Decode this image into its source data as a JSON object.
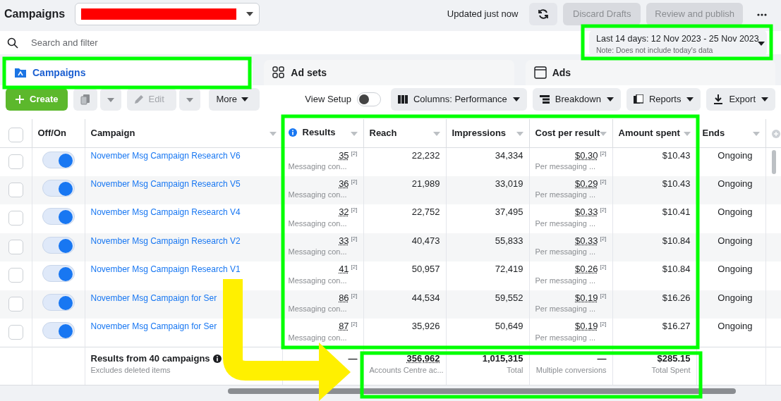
{
  "header": {
    "title": "Campaigns",
    "updated": "Updated just now",
    "buttons": [
      {
        "label": "Discard Drafts",
        "disabled": true
      },
      {
        "label": "Review and publish",
        "disabled": true
      }
    ]
  },
  "search": {
    "placeholder": "Search and filter"
  },
  "date_range": {
    "label": "Last 14 days: 12 Nov 2023 - 25 Nov 2023",
    "note": "Note: Does not include today's data"
  },
  "tabs": [
    {
      "label": "Campaigns",
      "kind": "campaigns",
      "selected": true
    },
    {
      "label": "Ad sets",
      "kind": "adsets",
      "selected": false
    },
    {
      "label": "Ads",
      "kind": "ads",
      "selected": false
    }
  ],
  "toolbar": {
    "create": "Create",
    "edit": {
      "label": "Edit",
      "disabled": true
    },
    "more": "More",
    "view_setup": {
      "label": "View Setup",
      "on": false
    },
    "tools": [
      {
        "label": "Columns: Performance",
        "kind": "columns"
      },
      {
        "label": "Breakdown",
        "kind": "breakdown"
      },
      {
        "label": "Reports",
        "kind": "reports"
      },
      {
        "label": "Export",
        "kind": "export"
      }
    ]
  },
  "table": {
    "select_all": {
      "checked": false
    },
    "columns": [
      "Off/On",
      "Campaign",
      "Results",
      "Reach",
      "Impressions",
      "Cost per result",
      "Amount spent",
      "Ends"
    ],
    "rows": [
      {
        "checked": false,
        "on": true,
        "name": "November Msg Campaign Research V6",
        "results": "35",
        "results_note": "[2]",
        "results_label": "Messaging con...",
        "reach": "22,232",
        "impressions": "34,334",
        "cost": "$0.30",
        "cost_note": "[2]",
        "cost_label": "Per messaging ...",
        "amount": "$10.43",
        "ends": "Ongoing"
      },
      {
        "checked": false,
        "on": true,
        "name": "November Msg Campaign Research V5",
        "results": "36",
        "results_note": "[2]",
        "results_label": "Messaging con...",
        "reach": "21,989",
        "impressions": "33,019",
        "cost": "$0.29",
        "cost_note": "[2]",
        "cost_label": "Per messaging ...",
        "amount": "$10.43",
        "ends": "Ongoing"
      },
      {
        "checked": false,
        "on": true,
        "name": "November Msg Campaign Research V4",
        "results": "32",
        "results_note": "[2]",
        "results_label": "Messaging con...",
        "reach": "22,752",
        "impressions": "37,495",
        "cost": "$0.33",
        "cost_note": "[2]",
        "cost_label": "Per messaging ...",
        "amount": "$10.41",
        "ends": "Ongoing"
      },
      {
        "checked": false,
        "on": true,
        "name": "November Msg Campaign Research V2",
        "results": "33",
        "results_note": "[2]",
        "results_label": "Messaging con...",
        "reach": "40,473",
        "impressions": "55,833",
        "cost": "$0.33",
        "cost_note": "[2]",
        "cost_label": "Per messaging ...",
        "amount": "$10.84",
        "ends": "Ongoing"
      },
      {
        "checked": false,
        "on": true,
        "name": "November Msg Campaign Research V1",
        "results": "41",
        "results_note": "[2]",
        "results_label": "Messaging con...",
        "reach": "50,957",
        "impressions": "72,419",
        "cost": "$0.26",
        "cost_note": "[2]",
        "cost_label": "Per messaging ...",
        "amount": "$10.84",
        "ends": "Ongoing"
      },
      {
        "checked": false,
        "on": true,
        "name": "November Msg Campaign for Ser",
        "results": "86",
        "results_note": "[2]",
        "results_label": "Messaging con...",
        "reach": "44,534",
        "impressions": "59,552",
        "cost": "$0.19",
        "cost_note": "[2]",
        "cost_label": "Per messaging ...",
        "amount": "$16.26",
        "ends": "Ongoing"
      },
      {
        "checked": false,
        "on": true,
        "name": "November Msg Campaign for Ser",
        "results": "87",
        "results_note": "[2]",
        "results_label": "Messaging con...",
        "reach": "35,926",
        "impressions": "50,649",
        "cost": "$0.19",
        "cost_note": "[2]",
        "cost_label": "Per messaging ...",
        "amount": "$16.27",
        "ends": "Ongoing"
      }
    ],
    "footer": {
      "title": "Results from 40 campaigns",
      "subtitle": "Excludes deleted items",
      "results": "—",
      "reach": "356,962",
      "reach_label": "Accounts Centre ac...",
      "impressions": "1,015,315",
      "impressions_label": "Total",
      "cost": "—",
      "cost_label": "Multiple conversions",
      "amount": "$285.15",
      "amount_label": "Total Spent"
    }
  }
}
